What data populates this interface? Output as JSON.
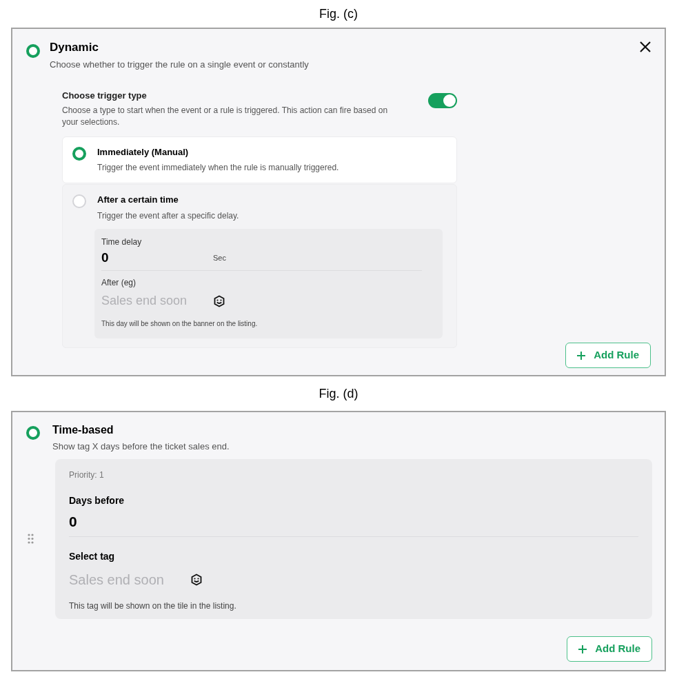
{
  "fig_c": {
    "caption": "Fig. (c)",
    "title": "Dynamic",
    "subtitle": "Choose whether to trigger the rule on a single event or constantly",
    "trigger": {
      "label": "Choose trigger type",
      "description": "Choose a type to start when the event or a rule is triggered. This action can fire based on your selections.",
      "on": true
    },
    "options": [
      {
        "title": "Immediately (Manual)",
        "description": "Trigger the event immediately when the rule is manually triggered.",
        "selected": true
      },
      {
        "title": "After a certain time",
        "description": "Trigger the event after a specific delay.",
        "selected": false,
        "delay": {
          "label": "Time delay",
          "value": "0",
          "unit": "Sec"
        },
        "after": {
          "label": "After (eg)",
          "placeholder": "Sales end soon",
          "hint": "This day will be shown on the banner on the listing."
        }
      }
    ],
    "add_button": "Add Rule"
  },
  "fig_d": {
    "caption": "Fig. (d)",
    "title": "Time-based",
    "subtitle": "Show tag X days before the ticket sales end.",
    "priority": "Priority: 1",
    "days": {
      "label": "Days before",
      "value": "0"
    },
    "tag": {
      "label": "Select tag",
      "placeholder": "Sales end soon",
      "hint": "This tag will be shown on the tile in the listing."
    },
    "add_button": "Add Rule"
  }
}
